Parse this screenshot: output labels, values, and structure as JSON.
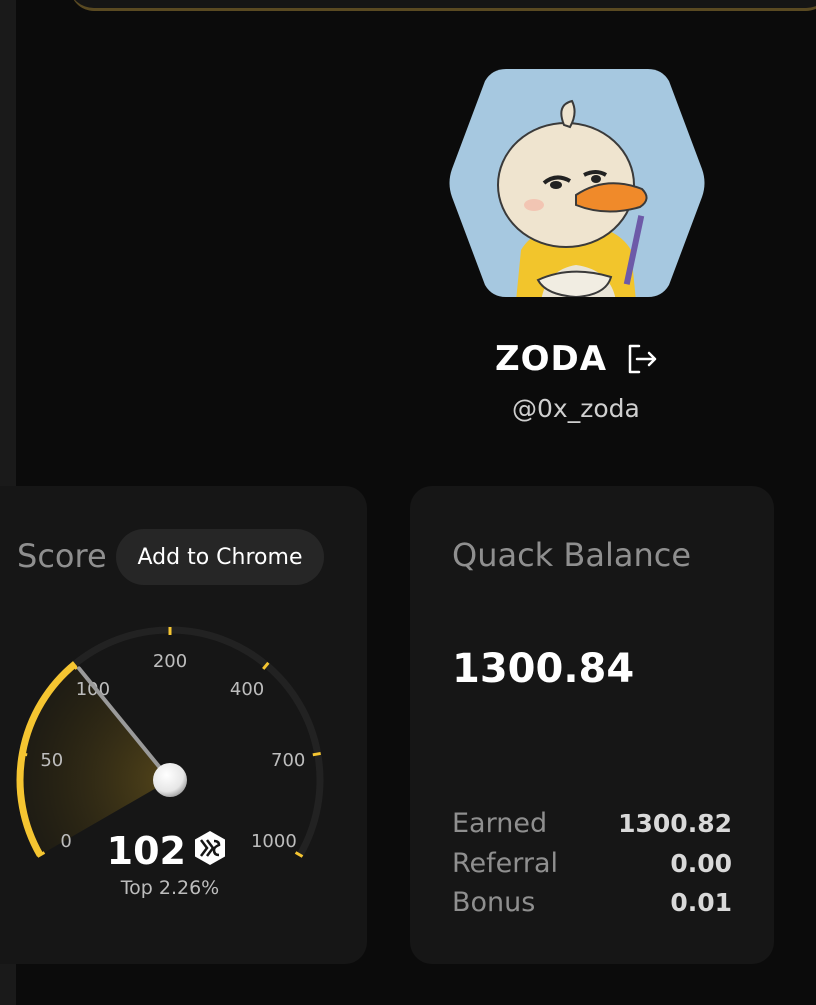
{
  "profile": {
    "display_name": "ZODA",
    "handle": "@0x_zoda"
  },
  "score_card": {
    "title": "Score",
    "add_to_chrome_label": "Add to Chrome",
    "score_value": "102",
    "rank_text": "Top 2.26%",
    "gauge_scale_labels": [
      "0",
      "50",
      "100",
      "200",
      "400",
      "700",
      "1000"
    ],
    "score": 102
  },
  "balance_card": {
    "title": "Quack Balance",
    "total": "1300.84",
    "stats": [
      {
        "label": "Earned",
        "value": "1300.82"
      },
      {
        "label": "Referral",
        "value": "0.00"
      },
      {
        "label": "Bonus",
        "value": "0.01"
      }
    ]
  },
  "colors": {
    "background": "#0b0b0b",
    "card": "#161616",
    "accent_yellow": "#f5c531",
    "muted_text": "#8f8f8f",
    "avatar_bg": "#a6c8e0"
  },
  "icons": [
    "logout-icon",
    "badge-icon"
  ]
}
